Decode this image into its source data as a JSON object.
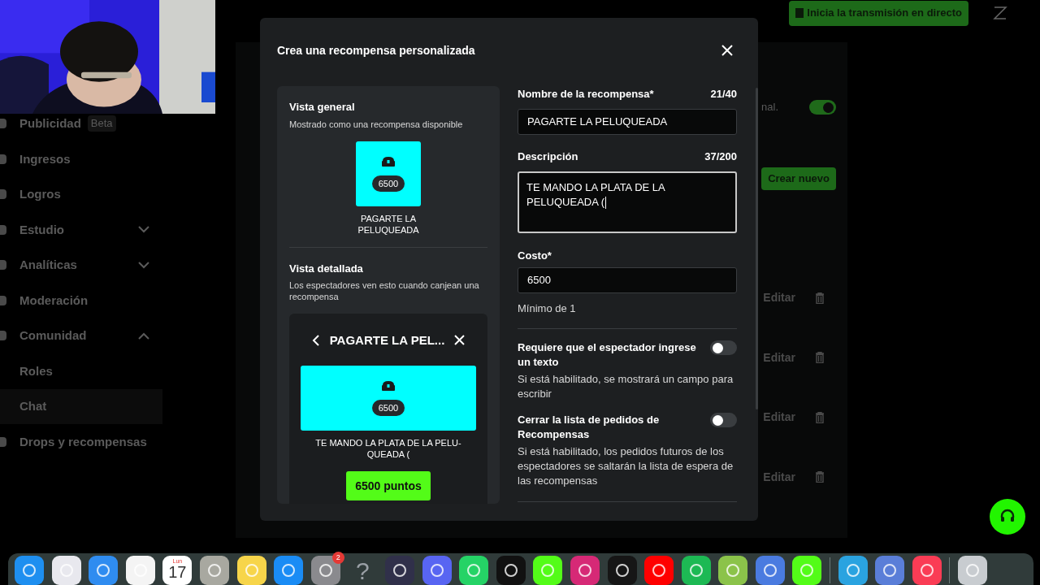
{
  "top_bar": {
    "live_button": "Inicia la transmisión en directo"
  },
  "sidebar": {
    "items": [
      {
        "label": "Publicidad",
        "badge": "Beta",
        "selected": false
      },
      {
        "label": "Ingresos",
        "selected": false
      },
      {
        "label": "Logros",
        "selected": false
      },
      {
        "label": "Estudio",
        "expanded": false,
        "selected": false
      },
      {
        "label": "Analíticas",
        "expanded": false,
        "selected": false
      },
      {
        "label": "Moderación",
        "selected": false
      },
      {
        "label": "Comunidad",
        "expanded": true,
        "selected": false,
        "children": [
          {
            "label": "Roles",
            "selected": false
          },
          {
            "label": "Chat",
            "selected": true
          }
        ]
      },
      {
        "label": "Drops y recompensas",
        "selected": false
      }
    ]
  },
  "background_panel": {
    "setting_text": "nal.",
    "setting_on": true,
    "create_button": "Crear nuevo",
    "rows": [
      {
        "action": "Editar"
      },
      {
        "action": "Editar"
      },
      {
        "action": "Editar"
      },
      {
        "action": "Editar"
      }
    ]
  },
  "modal": {
    "title": "Crea una recompensa personalizada",
    "preview": {
      "general_title": "Vista general",
      "general_subtitle": "Mostrado como una recompensa disponible",
      "tile_cost": "6500",
      "tile_name": "PAGARTE LA PELUQUEADA",
      "detail_title": "Vista detallada",
      "detail_subtitle": "Los espectadores ven esto cuando canjean una recompensa",
      "detail_header": "PAGARTE LA PEL...",
      "detail_cost": "6500",
      "detail_description": "TE MANDO LA PLATA DE LA PELU-QUEADA (",
      "redeem_button": "6500 puntos"
    },
    "form": {
      "name_label": "Nombre de la recompensa*",
      "name_count": "21/40",
      "name_value": "PAGARTE LA PELUQUEADA",
      "description_label": "Descripción",
      "description_count": "37/200",
      "description_value": "TE MANDO LA PLATA DE LA PELUQUEADA (",
      "cost_label": "Costo*",
      "cost_value": "6500",
      "cost_hint": "Mínimo de 1",
      "toggles": [
        {
          "title": "Requiere que el espectador ingrese un texto",
          "description": "Si está habilitado, se mostrará un campo para escribir",
          "on": false
        },
        {
          "title": "Cerrar la lista de pedidos de Recompensas",
          "description": "Si está habilitado, los pedidos futuros de los espectadores se saltarán la lista de espera de las recompensas",
          "on": false
        }
      ]
    }
  },
  "dock": [
    {
      "kind": "app",
      "color": "#1e8ff0"
    },
    {
      "kind": "app",
      "color": "#e8e8ee"
    },
    {
      "kind": "app",
      "color": "#2f8cf0"
    },
    {
      "kind": "app",
      "color": "#f4f4f4"
    },
    {
      "kind": "calendar",
      "month": "Lun",
      "day": "17"
    },
    {
      "kind": "app",
      "color": "#a8a8a0"
    },
    {
      "kind": "app",
      "color": "#f7d54a"
    },
    {
      "kind": "app",
      "color": "#1a8cf5"
    },
    {
      "kind": "app",
      "color": "#8a8a8e",
      "badge": "2"
    },
    {
      "kind": "glyph",
      "glyph": "?"
    },
    {
      "kind": "app",
      "color": "#30304a"
    },
    {
      "kind": "app",
      "color": "#5865f2"
    },
    {
      "kind": "app",
      "color": "#25d366"
    },
    {
      "kind": "app",
      "color": "#111111"
    },
    {
      "kind": "app",
      "color": "#53fc18"
    },
    {
      "kind": "app",
      "color": "#d62976"
    },
    {
      "kind": "app",
      "color": "#161616"
    },
    {
      "kind": "app",
      "color": "#ff0000"
    },
    {
      "kind": "app",
      "color": "#1db954"
    },
    {
      "kind": "app",
      "color": "#8bc34a"
    },
    {
      "kind": "app",
      "color": "#4a7be0"
    },
    {
      "kind": "app",
      "color": "#53fc18"
    },
    {
      "kind": "divider"
    },
    {
      "kind": "app",
      "color": "#2aa3e0"
    },
    {
      "kind": "app",
      "color": "#5a7ed8"
    },
    {
      "kind": "app",
      "color": "#fa3c55"
    },
    {
      "kind": "divider"
    },
    {
      "kind": "app",
      "color": "#c8ccd0"
    }
  ]
}
